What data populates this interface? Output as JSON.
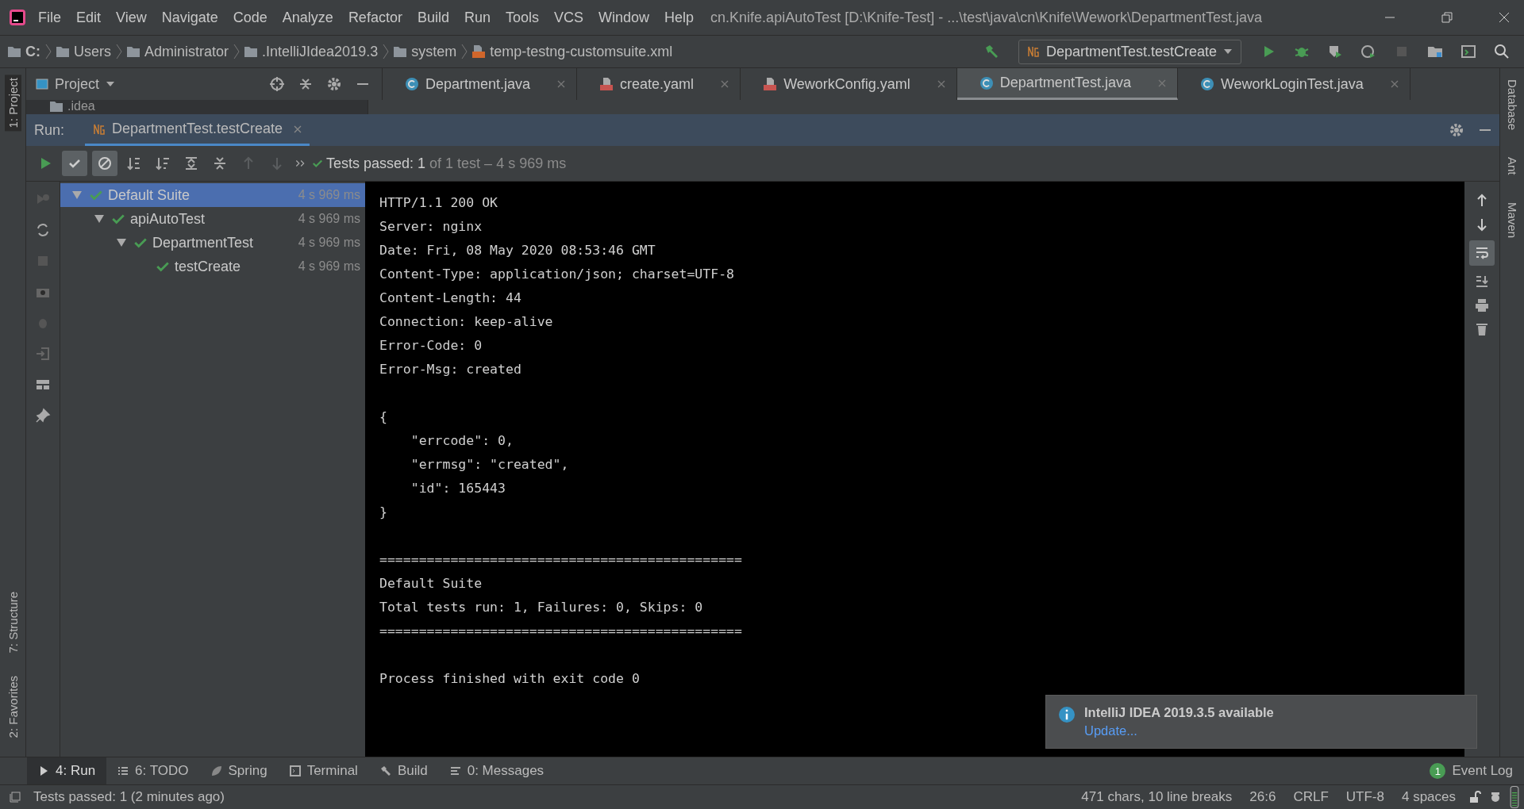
{
  "window": {
    "title": "cn.Knife.apiAutoTest [D:\\Knife-Test] - ...\\test\\java\\cn\\Knife\\Wework\\DepartmentTest.java"
  },
  "menu": [
    "File",
    "Edit",
    "View",
    "Navigate",
    "Code",
    "Analyze",
    "Refactor",
    "Build",
    "Run",
    "Tools",
    "VCS",
    "Window",
    "Help"
  ],
  "breadcrumbs": [
    {
      "label": "C:",
      "kind": "drive"
    },
    {
      "label": "Users",
      "kind": "folder"
    },
    {
      "label": "Administrator",
      "kind": "folder"
    },
    {
      "label": ".IntelliJIdea2019.3",
      "kind": "folder"
    },
    {
      "label": "system",
      "kind": "folder"
    },
    {
      "label": "temp-testng-customsuite.xml",
      "kind": "xml"
    }
  ],
  "run_config": {
    "label": "DepartmentTest.testCreate"
  },
  "project_pane": {
    "title": "Project",
    "items": [
      ".idea"
    ]
  },
  "editor_tabs": [
    {
      "label": "Department.java",
      "kind": "java",
      "selected": false
    },
    {
      "label": "create.yaml",
      "kind": "yaml",
      "selected": false
    },
    {
      "label": "WeworkConfig.yaml",
      "kind": "yaml",
      "selected": false
    },
    {
      "label": "DepartmentTest.java",
      "kind": "java",
      "selected": true
    },
    {
      "label": "WeworkLoginTest.java",
      "kind": "java",
      "selected": false
    }
  ],
  "left_stripe": {
    "top": [
      {
        "label": "1: Project",
        "selected": true
      }
    ],
    "bottom": [
      {
        "label": "7: Structure",
        "selected": false
      },
      {
        "label": "2: Favorites",
        "selected": false
      }
    ]
  },
  "right_stripe": [
    "Database",
    "Ant",
    "Maven"
  ],
  "run": {
    "label": "Run:",
    "tab": "DepartmentTest.testCreate",
    "toolbar": {
      "show_passed": true,
      "show_ignored": true
    },
    "status": {
      "main": "Tests passed: 1",
      "rest": "of 1 test – 4 s 969 ms"
    },
    "tree": [
      {
        "label": "Default Suite",
        "time": "4 s 969 ms",
        "selected": true,
        "expanded": true,
        "children": [
          {
            "label": "apiAutoTest",
            "time": "4 s 969 ms",
            "selected": false,
            "expanded": true,
            "children": [
              {
                "label": "DepartmentTest",
                "time": "4 s 969 ms",
                "selected": false,
                "expanded": true,
                "children": [
                  {
                    "label": "testCreate",
                    "time": "4 s 969 ms",
                    "selected": false
                  }
                ]
              }
            ]
          }
        ]
      }
    ],
    "console": [
      [
        "HTTP/1.1 200 OK",
        "Server: nginx",
        "Date: Fri, 08 May 2020 08:53:46 GMT",
        "Content-Type: application/json; charset=UTF-8",
        "Content-Length: 44",
        "Connection: keep-alive",
        "Error-Code: 0",
        "Error-Msg: created"
      ],
      [
        "{",
        "    \"errcode\": 0,",
        "    \"errmsg\": \"created\",",
        "    \"id\": 165443",
        "}"
      ],
      [
        "==============================================",
        "Default Suite",
        "Total tests run: 1, Failures: 0, Skips: 0",
        "=============================================="
      ],
      [
        "Process finished with exit code 0"
      ]
    ],
    "soft_wrap": true
  },
  "notification": {
    "title": "IntelliJ IDEA 2019.3.5 available",
    "link": "Update..."
  },
  "bottom_tabs": [
    {
      "label": "4: Run",
      "kind": "run",
      "selected": true
    },
    {
      "label": "6: TODO",
      "kind": "todo",
      "selected": false
    },
    {
      "label": "Spring",
      "kind": "spring",
      "selected": false
    },
    {
      "label": "Terminal",
      "kind": "terminal",
      "selected": false
    },
    {
      "label": "Build",
      "kind": "build",
      "selected": false
    },
    {
      "label": "0: Messages",
      "kind": "messages",
      "selected": false
    }
  ],
  "event_log": {
    "label": "Event Log",
    "count": "1"
  },
  "status_bar": {
    "message": "Tests passed: 1 (2 minutes ago)",
    "items": [
      "471 chars, 10 line breaks",
      "26:6",
      "CRLF",
      "UTF-8",
      "4 spaces"
    ]
  }
}
